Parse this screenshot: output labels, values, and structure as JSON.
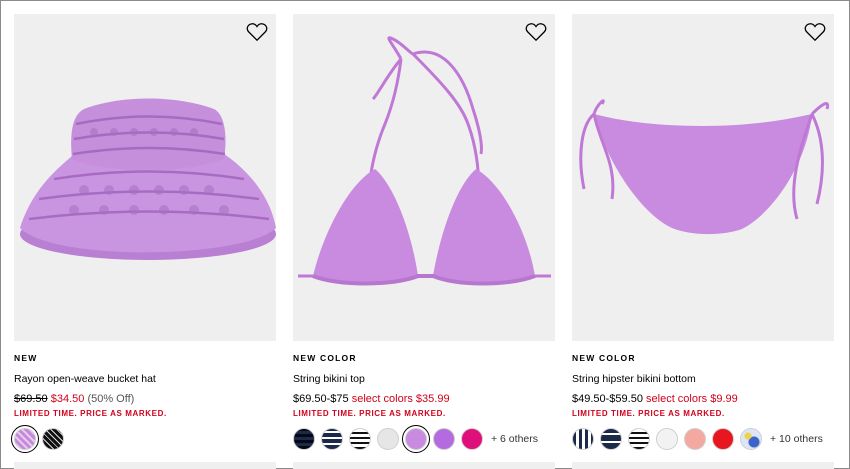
{
  "products": [
    {
      "badge": "NEW",
      "name": "Rayon open-weave bucket hat",
      "price_original": "$69.50",
      "price_sale": "$34.50",
      "price_discount": "(50% Off)",
      "promo": "LIMITED TIME. PRICE AS MARKED.",
      "swatches": [
        "lilac-crochet",
        "black-white-crochet"
      ],
      "more": ""
    },
    {
      "badge": "NEW COLOR",
      "name": "String bikini top",
      "price_range": "$69.50-$75",
      "price_select": "select colors $35.99",
      "promo": "LIMITED TIME. PRICE AS MARKED.",
      "swatches": [
        "navy-gingham",
        "navy-stripe",
        "black-white-stripe",
        "light-gray",
        "lilac",
        "orchid",
        "magenta"
      ],
      "more": "+ 6 others"
    },
    {
      "badge": "NEW COLOR",
      "name": "String hipster bikini bottom",
      "price_range": "$49.50-$59.50",
      "price_select": "select colors $9.99",
      "promo": "LIMITED TIME. PRICE AS MARKED.",
      "swatches": [
        "navy-gingham",
        "navy-solid",
        "black-white-stripe",
        "white",
        "peach",
        "red",
        "blue-floral"
      ],
      "more": "+ 10 others"
    }
  ],
  "colors": {
    "card_bg": "#efefef",
    "sale_red": "#d0021b",
    "lilac": "#c98be0"
  }
}
